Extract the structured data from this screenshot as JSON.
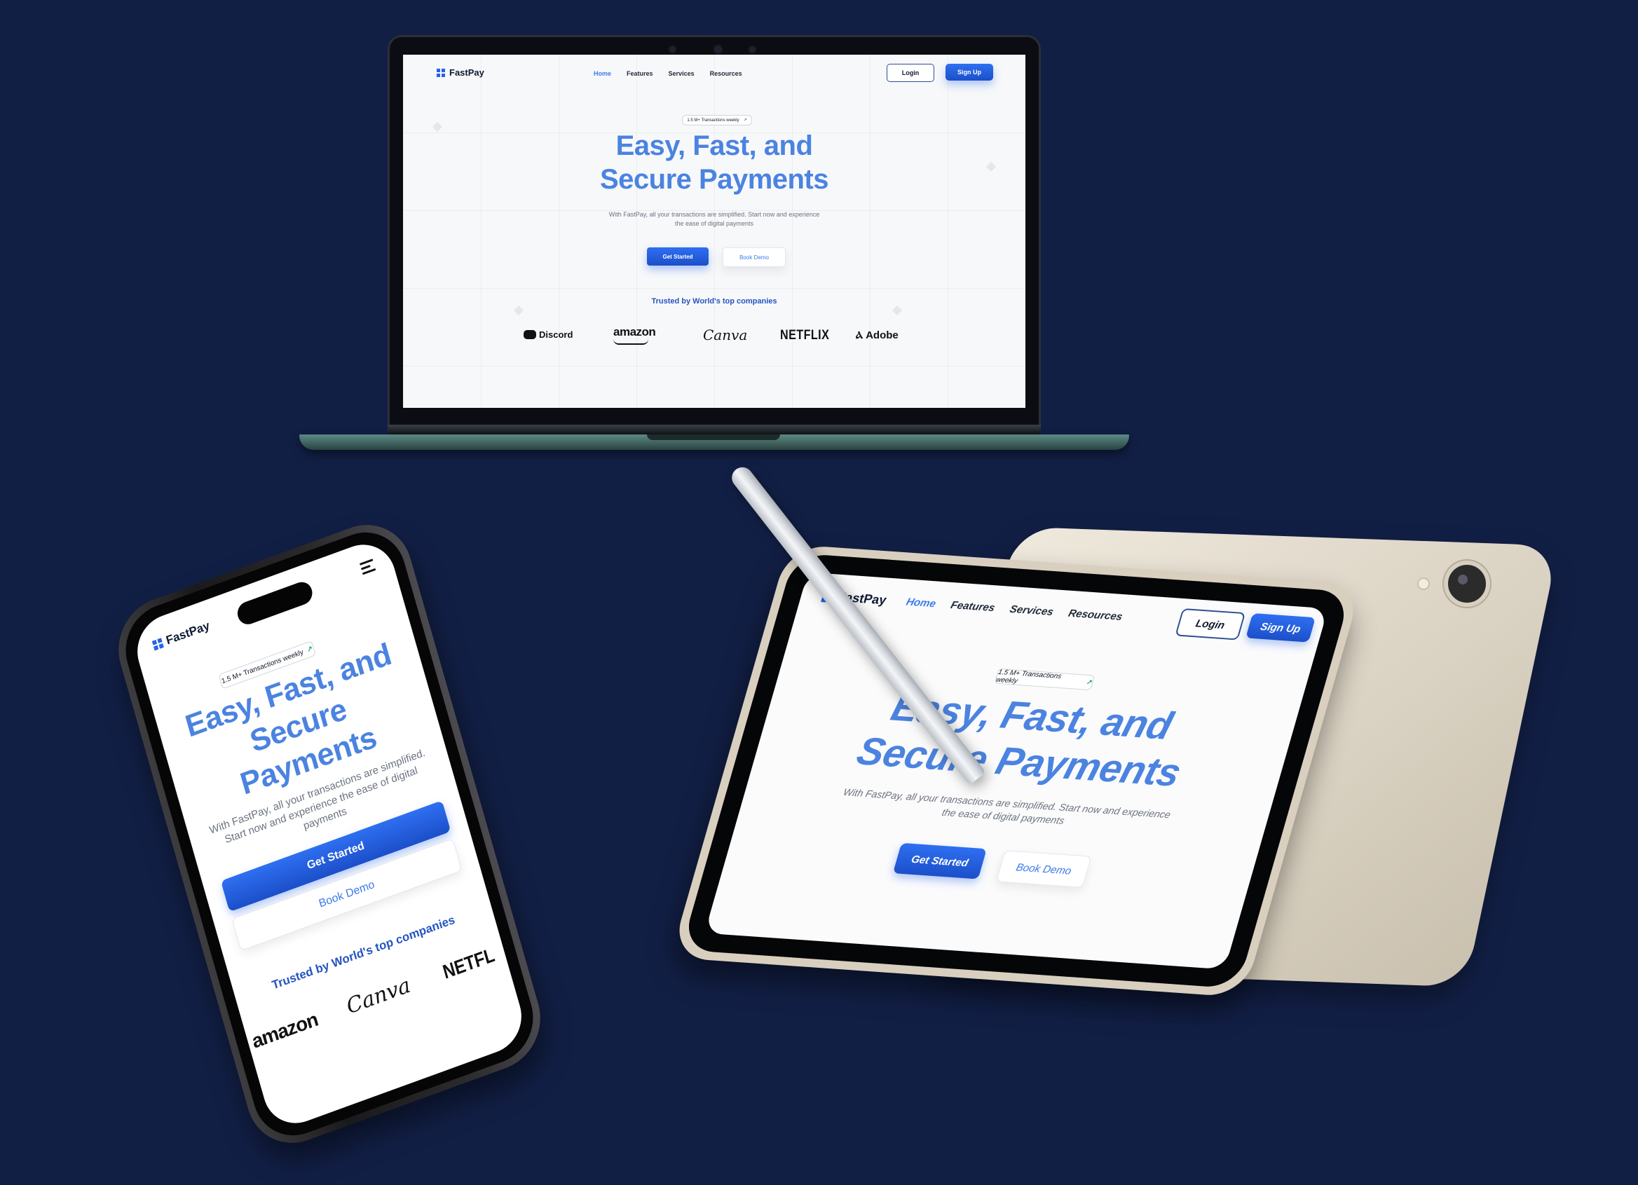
{
  "brand": {
    "name": "FastPay",
    "accent": "#2563eb",
    "headline_color": "#4b83e0",
    "background": "#121f45"
  },
  "nav": {
    "links": [
      "Home",
      "Features",
      "Services",
      "Resources"
    ],
    "login_label": "Login",
    "signup_label": "Sign Up"
  },
  "hero": {
    "badge_text": "1.5 M+ Transactions weekly",
    "badge_icon": "trend-up-icon",
    "headline_line1": "Easy, Fast, and",
    "headline_line2": "Secure Payments",
    "phone_headline_1": "Easy, Fast, and",
    "phone_headline_2": "Secure",
    "phone_headline_3": "Payments",
    "subtitle_line1": "With FastPay, all your transactions are simplified. Start now and experience",
    "subtitle_line2": "the ease of digital payments",
    "phone_sub_1": "With FastPay, all your transactions are simplified.",
    "phone_sub_2": "Start now and experience the ease of digital",
    "phone_sub_3": "payments",
    "primary_cta": "Get Started",
    "secondary_cta": "Book Demo"
  },
  "trusted": {
    "title": "Trusted by World's top companies",
    "logos": [
      "Discord",
      "amazon",
      "Canva",
      "NETFLIX",
      "Adobe"
    ],
    "phone_logos": [
      "amazon",
      "Canva",
      "NETFL"
    ]
  }
}
